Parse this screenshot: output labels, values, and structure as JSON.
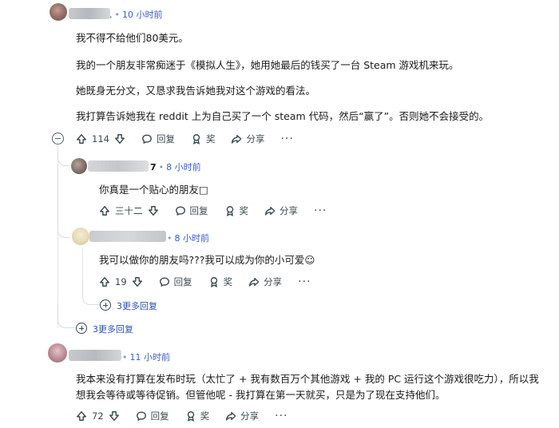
{
  "comments": [
    {
      "time": "10 小时前",
      "lines": [
        "我不得不给他们80美元。",
        "我的一个朋友非常痴迷于《模拟人生》，她用她最后的钱买了一台 Steam 游戏机来玩。",
        "她既身无分文，又恳求我告诉她我对这个游戏的看法。",
        "我打算告诉她我在 reddit 上为自己买了一个 steam 代码，然后“赢了”。否则她不会接受的。"
      ],
      "votes": "114",
      "reply": "回复",
      "award": "奖",
      "share": "分享",
      "more": "···"
    },
    {
      "username_suffix": "7",
      "time": "8 小时前",
      "lines": [
        "你真是一个贴心的朋友□"
      ],
      "votes": "三十二",
      "reply": "回复",
      "award": "奖",
      "share": "分享",
      "more": "···"
    },
    {
      "time": "8 小时前",
      "lines": [
        "我可以做你的朋友吗???我可以成为你的小可爱☺"
      ],
      "votes": "19",
      "reply": "回复",
      "award": "奖",
      "share": "分享",
      "more": "···",
      "more_replies": "3更多回复"
    },
    {
      "time": "11 小时前",
      "lines": [
        "我本来没有打算在发布时玩（太忙了 + 我有数百万个其他游戏 + 我的 PC 运行这个游戏很吃力），所以我",
        "想我会等待或等待促销。但管他呢 - 我打算在第一天就买，只是为了现在支持他们。"
      ],
      "votes": "72",
      "reply": "回复",
      "award": "奖",
      "share": "分享",
      "more": "···"
    }
  ],
  "thread_more_replies": "3更多回复",
  "colors": {
    "link": "#2a4fb8",
    "time": "#3b5bdb",
    "line": "#e0e4e6"
  }
}
